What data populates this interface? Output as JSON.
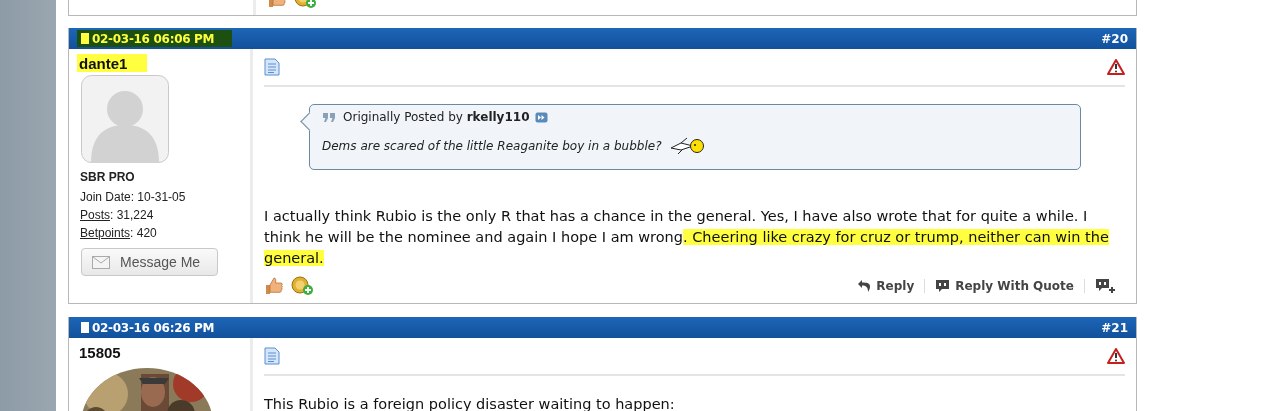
{
  "posts": [
    {
      "date": "02-03-16 06:06 PM",
      "date_highlighted": true,
      "number": "#20",
      "username": "dante1",
      "username_highlighted": true,
      "avatar": {
        "kind": "silhouette"
      },
      "rank": "SBR PRO",
      "stats": [
        {
          "kind": "text",
          "text": "Join Date: 10-31-05"
        },
        {
          "kind": "link",
          "link": "Posts",
          "text": ": 31,224"
        },
        {
          "kind": "link",
          "link": "Betpoints",
          "text": ": 420"
        }
      ],
      "message_button": "Message Me",
      "quote": {
        "label": "Originally Posted by",
        "author": "rkelly110",
        "text": "Dems are scared of the little Reaganite boy in a bubble?"
      },
      "message": [
        {
          "text": "I actually think Rubio is the only R that has a chance in the general. Yes, I have also wrote that for quite a while. I think he will be the nominee and again I hope I am wrong",
          "highlighted": false
        },
        {
          "text": ". Cheering like crazy for cruz or trump, neither can win the general.",
          "highlighted": true
        }
      ],
      "actions": [
        "Reply",
        "Reply With Quote"
      ]
    },
    {
      "date": "02-03-16 06:26 PM",
      "date_highlighted": false,
      "number": "#21",
      "username": "15805",
      "username_highlighted": false,
      "avatar": {
        "kind": "picture"
      },
      "message": [
        {
          "text": "This Rubio is a foreign policy disaster waiting to happen:",
          "highlighted": false
        }
      ]
    }
  ]
}
